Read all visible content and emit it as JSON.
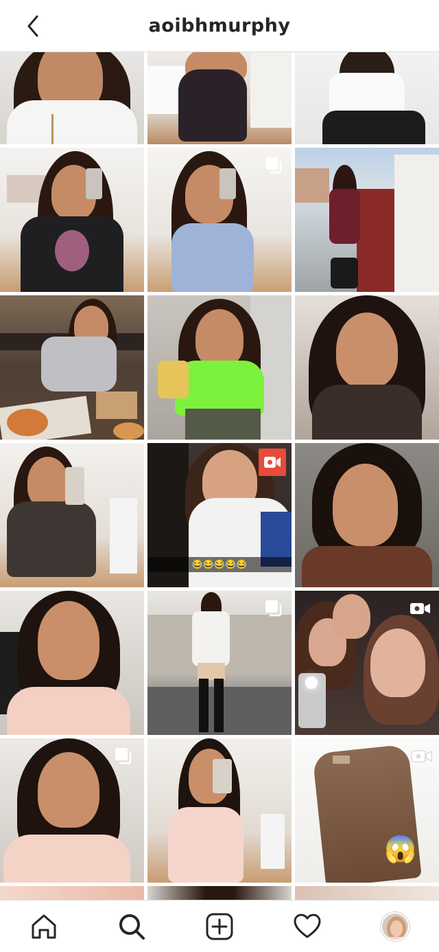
{
  "header": {
    "username": "aoibhmurphy"
  },
  "grid": {
    "tiles": [
      {
        "kind": "photo",
        "badge": "none"
      },
      {
        "kind": "photo",
        "badge": "none"
      },
      {
        "kind": "photo",
        "badge": "none"
      },
      {
        "kind": "photo",
        "badge": "none"
      },
      {
        "kind": "carousel",
        "badge": "carousel-icon"
      },
      {
        "kind": "photo",
        "badge": "none"
      },
      {
        "kind": "photo",
        "badge": "none"
      },
      {
        "kind": "photo",
        "badge": "none"
      },
      {
        "kind": "photo",
        "badge": "none"
      },
      {
        "kind": "photo",
        "badge": "none"
      },
      {
        "kind": "video",
        "badge": "video-icon",
        "caption": "😂😂😂😂😂"
      },
      {
        "kind": "photo",
        "badge": "none"
      },
      {
        "kind": "photo",
        "badge": "none"
      },
      {
        "kind": "carousel",
        "badge": "carousel-icon"
      },
      {
        "kind": "video",
        "badge": "video-icon"
      },
      {
        "kind": "carousel",
        "badge": "carousel-icon"
      },
      {
        "kind": "photo",
        "badge": "none"
      },
      {
        "kind": "video",
        "badge": "video-icon",
        "emoji": "😱"
      }
    ]
  },
  "nav": {
    "items": [
      "home-icon",
      "search-icon",
      "new-post-icon",
      "activity-heart-icon",
      "profile-avatar"
    ]
  },
  "colors": {
    "border": "#dbdbdb",
    "text": "#262626",
    "background": "#ffffff"
  }
}
